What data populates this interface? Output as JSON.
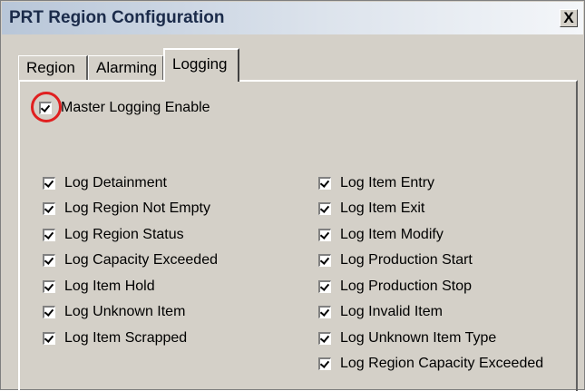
{
  "window": {
    "title": "PRT Region Configuration",
    "close_label": "X"
  },
  "tabs": [
    {
      "label": "Region",
      "active": false
    },
    {
      "label": "Alarming",
      "active": false
    },
    {
      "label": "Logging",
      "active": true
    }
  ],
  "master": {
    "label": "Master Logging Enable",
    "checked": true
  },
  "left_options": [
    {
      "label": "Log Detainment",
      "checked": true
    },
    {
      "label": "Log Region Not Empty",
      "checked": true
    },
    {
      "label": "Log Region Status",
      "checked": true
    },
    {
      "label": "Log Capacity Exceeded",
      "checked": true
    },
    {
      "label": "Log Item Hold",
      "checked": true
    },
    {
      "label": "Log Unknown Item",
      "checked": true
    },
    {
      "label": "Log Item Scrapped",
      "checked": true
    }
  ],
  "right_options": [
    {
      "label": "Log Item Entry",
      "checked": true
    },
    {
      "label": "Log Item Exit",
      "checked": true
    },
    {
      "label": "Log Item Modify",
      "checked": true
    },
    {
      "label": "Log Production Start",
      "checked": true
    },
    {
      "label": "Log Production Stop",
      "checked": true
    },
    {
      "label": "Log Invalid Item",
      "checked": true
    },
    {
      "label": "Log Unknown Item Type",
      "checked": true
    },
    {
      "label": "Log Region Capacity Exceeded",
      "checked": true
    }
  ]
}
